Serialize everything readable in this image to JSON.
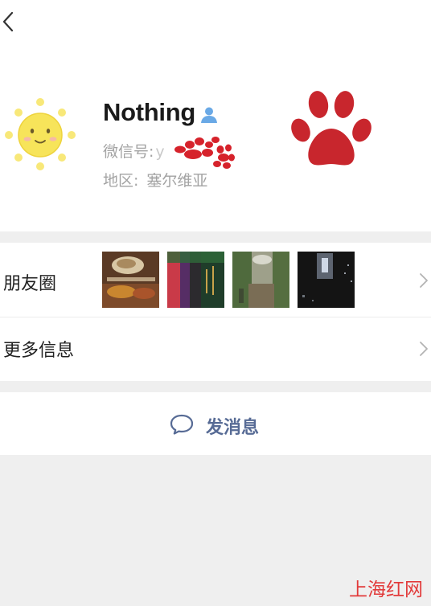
{
  "profile": {
    "name": "Nothing",
    "wechat_id_label": "微信号:",
    "wechat_id_visible": "y",
    "region_label": "地区:",
    "region_value": "塞尔维亚"
  },
  "rows": {
    "moments_label": "朋友圈",
    "more_info_label": "更多信息"
  },
  "actions": {
    "send_message_label": "发消息"
  },
  "watermark": {
    "text": "上海红网"
  },
  "colors": {
    "link_blue": "#576b95",
    "paw_red": "#c8262d",
    "sun_yellow": "#f7e45a",
    "background": "#efefef",
    "watermark_red": "#e23a3a"
  },
  "icons": {
    "back": "chevron-left-icon",
    "contact": "contact-person-icon",
    "chevron": "chevron-right-icon",
    "message": "chat-bubble-icon"
  }
}
